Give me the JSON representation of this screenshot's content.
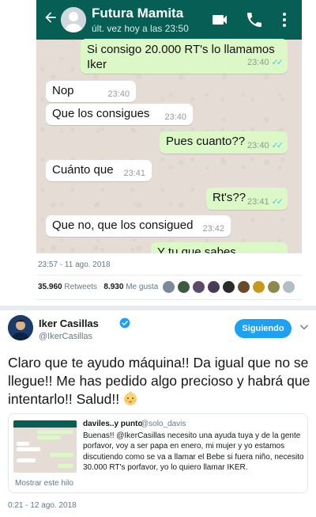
{
  "whatsapp": {
    "contact_name": "Futura Mamita",
    "status": "últ. vez hoy a las 23:50",
    "messages": [
      {
        "dir": "out",
        "text": "Si consigo 20.000 RT's lo llamamos",
        "text2": "Iker",
        "time": "23:40"
      },
      {
        "dir": "in",
        "text": "Nop",
        "time": "23:40"
      },
      {
        "dir": "in",
        "text": "Que los consigues",
        "time": "23:40"
      },
      {
        "dir": "out",
        "text": "Pues cuanto??",
        "time": "23:40"
      },
      {
        "dir": "in",
        "text": "Cuánto que",
        "time": "23:41"
      },
      {
        "dir": "out",
        "text": "Rt's??",
        "time": "23:41"
      },
      {
        "dir": "in",
        "text": "Que no, que los consigued",
        "time": "23:42"
      },
      {
        "dir": "out",
        "text": "Y tu que sabes",
        "time": ""
      }
    ]
  },
  "first_tweet": {
    "date": "23:57 - 11 ago. 2018",
    "retweets_count": "35.960",
    "retweets_label": "Retweets",
    "likes_count": "8.930",
    "likes_label": "Me gusta"
  },
  "tweet": {
    "author_name": "Iker Casillas",
    "author_handle": "@IkerCasillas",
    "follow_label": "Siguiendo",
    "text": "Claro que te ayudo máquina!! Da igual que no se llegue!! Me has pedido algo precioso y habrá que intentarlo!! Salud!!",
    "date": "0:21 - 12 ago. 2018"
  },
  "quoted_tweet": {
    "author_name": "daviles..y punto",
    "author_handle": "@solo_davis",
    "text": "Buenas!! @IkerCasillas necesito una ayuda tuya y de la gente porfavor, voy a ser papa en enero, mi mujer y yo estamos discutiendo como se va a llamar el Bebe si fuera niño, necesito 30.000 RT's porfavor, yo lo quiero llamar IKER.",
    "show_thread": "Mostrar este hilo"
  },
  "colors": {
    "whatsapp_header": "#075e54",
    "outgoing_bubble": "#dcf8c6",
    "chat_background": "#e5ddd5",
    "twitter_blue": "#1da1f2",
    "read_ticks": "#4fc3f7"
  },
  "icons": [
    "back-arrow-icon",
    "video-call-icon",
    "phone-icon",
    "more-options-icon",
    "verified-badge-icon",
    "chevron-down-icon",
    "baby-emoji"
  ]
}
